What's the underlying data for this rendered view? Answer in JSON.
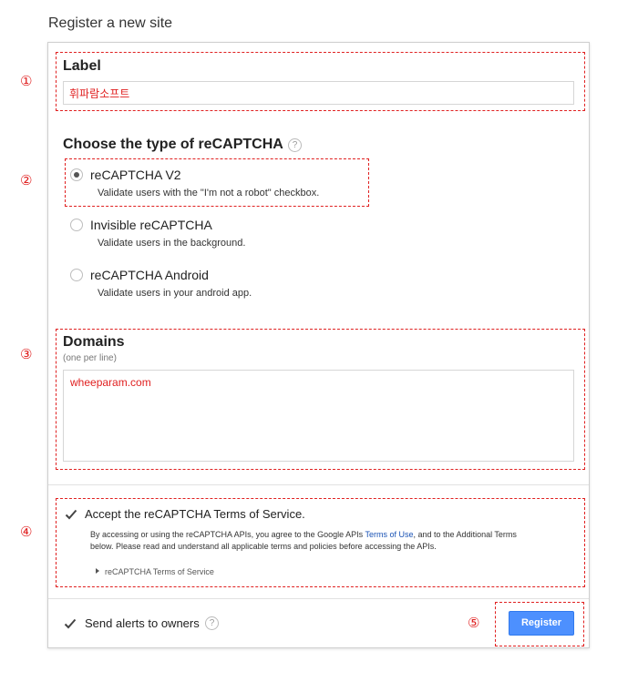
{
  "page": {
    "title": "Register a new site"
  },
  "markers": [
    "①",
    "②",
    "③",
    "④",
    "⑤"
  ],
  "label_section": {
    "title": "Label",
    "value": "휘파람소프트"
  },
  "type_section": {
    "title": "Choose the type of reCAPTCHA",
    "help_icon": "?",
    "options": [
      {
        "title": "reCAPTCHA V2",
        "desc": "Validate users with the \"I'm not a robot\" checkbox.",
        "selected": true
      },
      {
        "title": "Invisible reCAPTCHA",
        "desc": "Validate users in the background.",
        "selected": false
      },
      {
        "title": "reCAPTCHA Android",
        "desc": "Validate users in your android app.",
        "selected": false
      }
    ]
  },
  "domains_section": {
    "title": "Domains",
    "hint": "(one per line)",
    "value": "wheeparam.com"
  },
  "tos_section": {
    "accept_label": "Accept the reCAPTCHA Terms of Service.",
    "accepted": true,
    "text_before_link": "By accessing or using the reCAPTCHA APIs, you agree to the Google APIs ",
    "link_text": "Terms of Use",
    "text_after_link": ", and to the Additional Terms below. Please read and understand all applicable terms and policies before accessing the APIs.",
    "toggle_label": "reCAPTCHA Terms of Service"
  },
  "footer": {
    "alerts_label": "Send alerts to owners",
    "alerts_checked": true,
    "help_icon": "?",
    "register_label": "Register"
  },
  "colors": {
    "annotation": "#e02020",
    "primary_button": "#4d90fe",
    "link": "#1a53b5"
  }
}
